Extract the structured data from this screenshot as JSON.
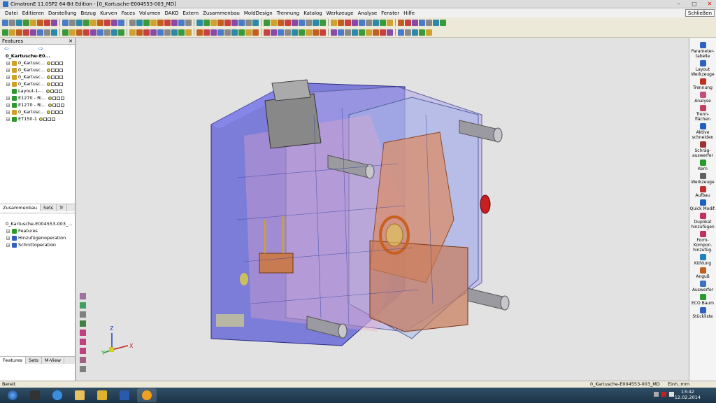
{
  "window": {
    "title": "CimatronE 11.0SP2 64-Bit Edition - [0_Kartusche-E004553-003_MD]",
    "close_label": "Schließen"
  },
  "menu": [
    "Datei",
    "Editieren",
    "Darstellung",
    "Bezug",
    "Kurven",
    "Faces",
    "Volumen",
    "DAKO",
    "Extern",
    "Zusammenbau",
    "MoldDesign",
    "Trennung",
    "Katalog",
    "Werkzeuge",
    "Analyse",
    "Fenster",
    "Hilfe"
  ],
  "features_panel": {
    "title": "Features",
    "root": "0_Kartusche-E0...",
    "items": [
      {
        "label": "0_Kartusc...",
        "expandable": true,
        "color": "#d4a020"
      },
      {
        "label": "0_Kartusc...",
        "expandable": true,
        "color": "#d4a020"
      },
      {
        "label": "0_Kartusc...",
        "expandable": true,
        "color": "#d4a020"
      },
      {
        "label": "0_Kartusc...",
        "expandable": true,
        "color": "#d4a020"
      },
      {
        "label": "Layout-1-...",
        "expandable": false,
        "color": "#2a9a2a"
      },
      {
        "label": "E1270 - Ri...",
        "expandable": true,
        "color": "#2a9a2a"
      },
      {
        "label": "E1270 - Ri...",
        "expandable": true,
        "color": "#2a9a2a"
      },
      {
        "label": "0_Kartusc...",
        "expandable": true,
        "color": "#d4a020"
      },
      {
        "label": "ET150-1",
        "expandable": true,
        "color": "#2a9a2a"
      }
    ],
    "tabs": [
      "Zusammenbau",
      "Sets",
      "Tr"
    ]
  },
  "ops_panel": {
    "root": "0_Kartusche-E004553-003_...",
    "items": [
      "Features",
      "Hinzufügenoperation",
      "Schnittoperation"
    ],
    "tabs": [
      "Features",
      "Sets",
      "M-View"
    ]
  },
  "right_panel": [
    {
      "label": "Parameter-tabelle",
      "color": "#3060c0"
    },
    {
      "label": "Layout Werkzeuge",
      "color": "#3060c0"
    },
    {
      "label": "Trennung",
      "color": "#c03020"
    },
    {
      "label": "Analyse",
      "color": "#c05080"
    },
    {
      "label": "Trenn-flächen",
      "color": "#c04060"
    },
    {
      "label": "Aktive schneiden",
      "color": "#2060c0"
    },
    {
      "label": "Schräg-auswerfer",
      "color": "#a03030"
    },
    {
      "label": "Kern",
      "color": "#2a9a2a"
    },
    {
      "label": "Werkzeuge",
      "color": "#606060"
    },
    {
      "label": "Aufbau",
      "color": "#c03030"
    },
    {
      "label": "Quick Modif.",
      "color": "#2060c0"
    },
    {
      "label": "Duplikat hinzufügen",
      "color": "#c03060"
    },
    {
      "label": "Form-Kompon. hinzufüg.",
      "color": "#c03060"
    },
    {
      "label": "Kühlung",
      "color": "#2080c0"
    },
    {
      "label": "Anguß",
      "color": "#c06020"
    },
    {
      "label": "Auswerfer",
      "color": "#4070c0"
    },
    {
      "label": "ECO Baum",
      "color": "#2a9a2a"
    },
    {
      "label": "Stückliste",
      "color": "#3060c0"
    }
  ],
  "axis": {
    "x": "X",
    "y": "Y",
    "z": "Z"
  },
  "status": {
    "left": "Bereit",
    "doc": "0_Kartusche-E004553-003_MD",
    "units": "Einh.:mm"
  },
  "clock": {
    "time": "13:42",
    "date": "12.02.2014"
  }
}
